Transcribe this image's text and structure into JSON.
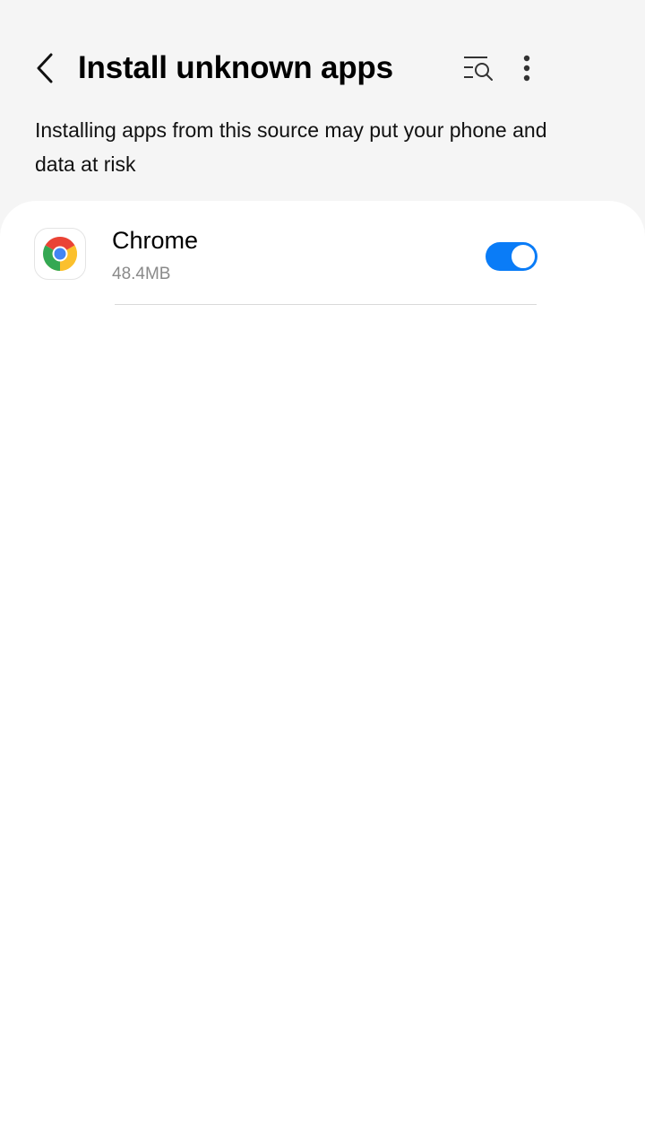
{
  "header": {
    "title": "Install unknown apps",
    "back_icon": "back-chevron-icon",
    "search_icon": "list-search-icon",
    "more_icon": "more-vert-icon"
  },
  "description": "Installing apps from this source may put your phone and data at risk",
  "apps": [
    {
      "name": "Chrome",
      "size": "48.4MB",
      "icon": "chrome-icon",
      "allowed": true
    }
  ],
  "colors": {
    "accent": "#0a7cf7",
    "background": "#f5f5f5",
    "card": "#ffffff",
    "secondary_text": "#8a8a8a"
  }
}
